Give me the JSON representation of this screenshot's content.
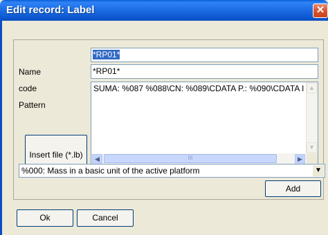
{
  "window": {
    "title": "Edit record: Label",
    "close_glyph": "✕"
  },
  "form": {
    "name_label": "Name",
    "name_value": "*RP01*",
    "code_label": "code",
    "code_value": "*RP01*",
    "pattern_label": "Pattern",
    "pattern_value": "SUMA: %087 %088\\CN: %089\\CDATA P.: %090\\CDATA I",
    "insert_file_label": "Insert file (*.lb)"
  },
  "scrollbar": {
    "up_glyph": "▲",
    "down_glyph": "▼",
    "left_glyph": "◀",
    "right_glyph": "▶",
    "thumb_grip": "III"
  },
  "macro_combo": {
    "selected": "%000: Mass in a basic unit of the active platform",
    "arrow_glyph": "▼"
  },
  "buttons": {
    "add": "Add",
    "ok": "Ok",
    "cancel": "Cancel"
  },
  "colors": {
    "title_bar": "#0a5fd8",
    "close_button": "#d9542f",
    "dialog_face": "#ece9d8",
    "selection": "#316ac5",
    "input_border": "#7f9db9"
  }
}
